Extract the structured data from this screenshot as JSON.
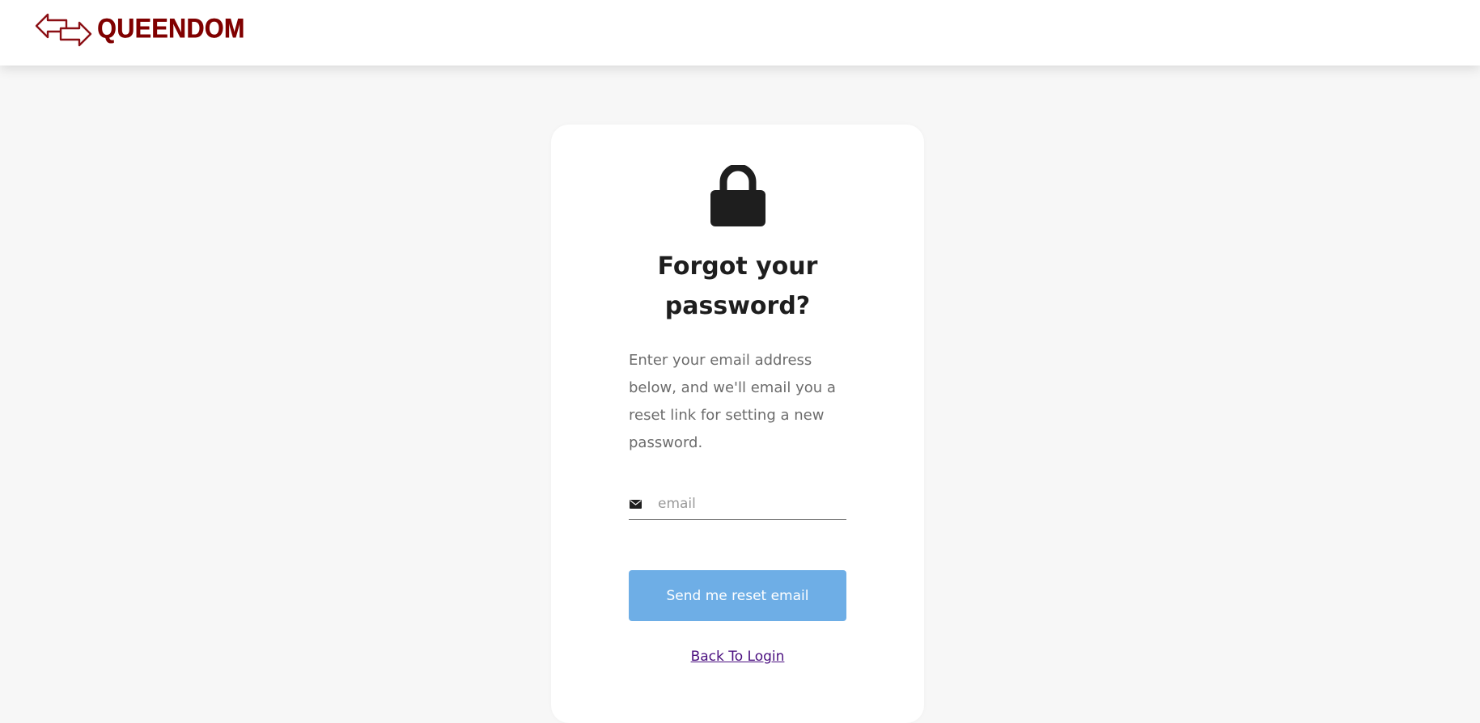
{
  "header": {
    "brand_name": "QUEENDOM",
    "logo_icon": "exchange-arrows-icon",
    "brand_color": "#800000"
  },
  "card": {
    "icon": "lock-icon",
    "title": "Forgot your password?",
    "description": "Enter your email address below, and we'll email you a reset link for setting a new password.",
    "email_field": {
      "icon": "envelope-icon",
      "placeholder": "email",
      "value": ""
    },
    "submit_label": "Send me reset email",
    "submit_color": "#6eaee6",
    "back_link_label": "Back To Login",
    "link_color": "#4b1080"
  }
}
